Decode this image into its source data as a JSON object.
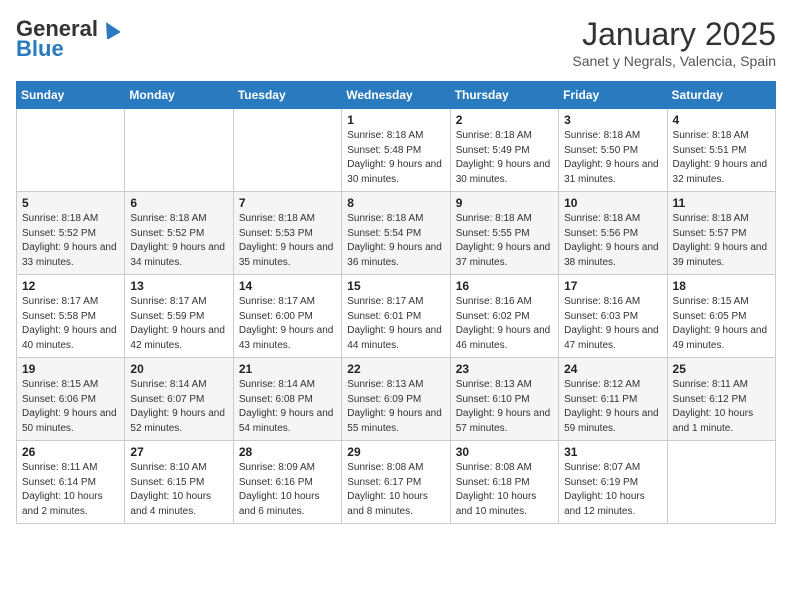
{
  "logo": {
    "general": "General",
    "blue": "Blue"
  },
  "title": "January 2025",
  "location": "Sanet y Negrals, Valencia, Spain",
  "days_of_week": [
    "Sunday",
    "Monday",
    "Tuesday",
    "Wednesday",
    "Thursday",
    "Friday",
    "Saturday"
  ],
  "weeks": [
    [
      {
        "day": "",
        "info": ""
      },
      {
        "day": "",
        "info": ""
      },
      {
        "day": "",
        "info": ""
      },
      {
        "day": "1",
        "info": "Sunrise: 8:18 AM\nSunset: 5:48 PM\nDaylight: 9 hours and 30 minutes."
      },
      {
        "day": "2",
        "info": "Sunrise: 8:18 AM\nSunset: 5:49 PM\nDaylight: 9 hours and 30 minutes."
      },
      {
        "day": "3",
        "info": "Sunrise: 8:18 AM\nSunset: 5:50 PM\nDaylight: 9 hours and 31 minutes."
      },
      {
        "day": "4",
        "info": "Sunrise: 8:18 AM\nSunset: 5:51 PM\nDaylight: 9 hours and 32 minutes."
      }
    ],
    [
      {
        "day": "5",
        "info": "Sunrise: 8:18 AM\nSunset: 5:52 PM\nDaylight: 9 hours and 33 minutes."
      },
      {
        "day": "6",
        "info": "Sunrise: 8:18 AM\nSunset: 5:52 PM\nDaylight: 9 hours and 34 minutes."
      },
      {
        "day": "7",
        "info": "Sunrise: 8:18 AM\nSunset: 5:53 PM\nDaylight: 9 hours and 35 minutes."
      },
      {
        "day": "8",
        "info": "Sunrise: 8:18 AM\nSunset: 5:54 PM\nDaylight: 9 hours and 36 minutes."
      },
      {
        "day": "9",
        "info": "Sunrise: 8:18 AM\nSunset: 5:55 PM\nDaylight: 9 hours and 37 minutes."
      },
      {
        "day": "10",
        "info": "Sunrise: 8:18 AM\nSunset: 5:56 PM\nDaylight: 9 hours and 38 minutes."
      },
      {
        "day": "11",
        "info": "Sunrise: 8:18 AM\nSunset: 5:57 PM\nDaylight: 9 hours and 39 minutes."
      }
    ],
    [
      {
        "day": "12",
        "info": "Sunrise: 8:17 AM\nSunset: 5:58 PM\nDaylight: 9 hours and 40 minutes."
      },
      {
        "day": "13",
        "info": "Sunrise: 8:17 AM\nSunset: 5:59 PM\nDaylight: 9 hours and 42 minutes."
      },
      {
        "day": "14",
        "info": "Sunrise: 8:17 AM\nSunset: 6:00 PM\nDaylight: 9 hours and 43 minutes."
      },
      {
        "day": "15",
        "info": "Sunrise: 8:17 AM\nSunset: 6:01 PM\nDaylight: 9 hours and 44 minutes."
      },
      {
        "day": "16",
        "info": "Sunrise: 8:16 AM\nSunset: 6:02 PM\nDaylight: 9 hours and 46 minutes."
      },
      {
        "day": "17",
        "info": "Sunrise: 8:16 AM\nSunset: 6:03 PM\nDaylight: 9 hours and 47 minutes."
      },
      {
        "day": "18",
        "info": "Sunrise: 8:15 AM\nSunset: 6:05 PM\nDaylight: 9 hours and 49 minutes."
      }
    ],
    [
      {
        "day": "19",
        "info": "Sunrise: 8:15 AM\nSunset: 6:06 PM\nDaylight: 9 hours and 50 minutes."
      },
      {
        "day": "20",
        "info": "Sunrise: 8:14 AM\nSunset: 6:07 PM\nDaylight: 9 hours and 52 minutes."
      },
      {
        "day": "21",
        "info": "Sunrise: 8:14 AM\nSunset: 6:08 PM\nDaylight: 9 hours and 54 minutes."
      },
      {
        "day": "22",
        "info": "Sunrise: 8:13 AM\nSunset: 6:09 PM\nDaylight: 9 hours and 55 minutes."
      },
      {
        "day": "23",
        "info": "Sunrise: 8:13 AM\nSunset: 6:10 PM\nDaylight: 9 hours and 57 minutes."
      },
      {
        "day": "24",
        "info": "Sunrise: 8:12 AM\nSunset: 6:11 PM\nDaylight: 9 hours and 59 minutes."
      },
      {
        "day": "25",
        "info": "Sunrise: 8:11 AM\nSunset: 6:12 PM\nDaylight: 10 hours and 1 minute."
      }
    ],
    [
      {
        "day": "26",
        "info": "Sunrise: 8:11 AM\nSunset: 6:14 PM\nDaylight: 10 hours and 2 minutes."
      },
      {
        "day": "27",
        "info": "Sunrise: 8:10 AM\nSunset: 6:15 PM\nDaylight: 10 hours and 4 minutes."
      },
      {
        "day": "28",
        "info": "Sunrise: 8:09 AM\nSunset: 6:16 PM\nDaylight: 10 hours and 6 minutes."
      },
      {
        "day": "29",
        "info": "Sunrise: 8:08 AM\nSunset: 6:17 PM\nDaylight: 10 hours and 8 minutes."
      },
      {
        "day": "30",
        "info": "Sunrise: 8:08 AM\nSunset: 6:18 PM\nDaylight: 10 hours and 10 minutes."
      },
      {
        "day": "31",
        "info": "Sunrise: 8:07 AM\nSunset: 6:19 PM\nDaylight: 10 hours and 12 minutes."
      },
      {
        "day": "",
        "info": ""
      }
    ]
  ]
}
